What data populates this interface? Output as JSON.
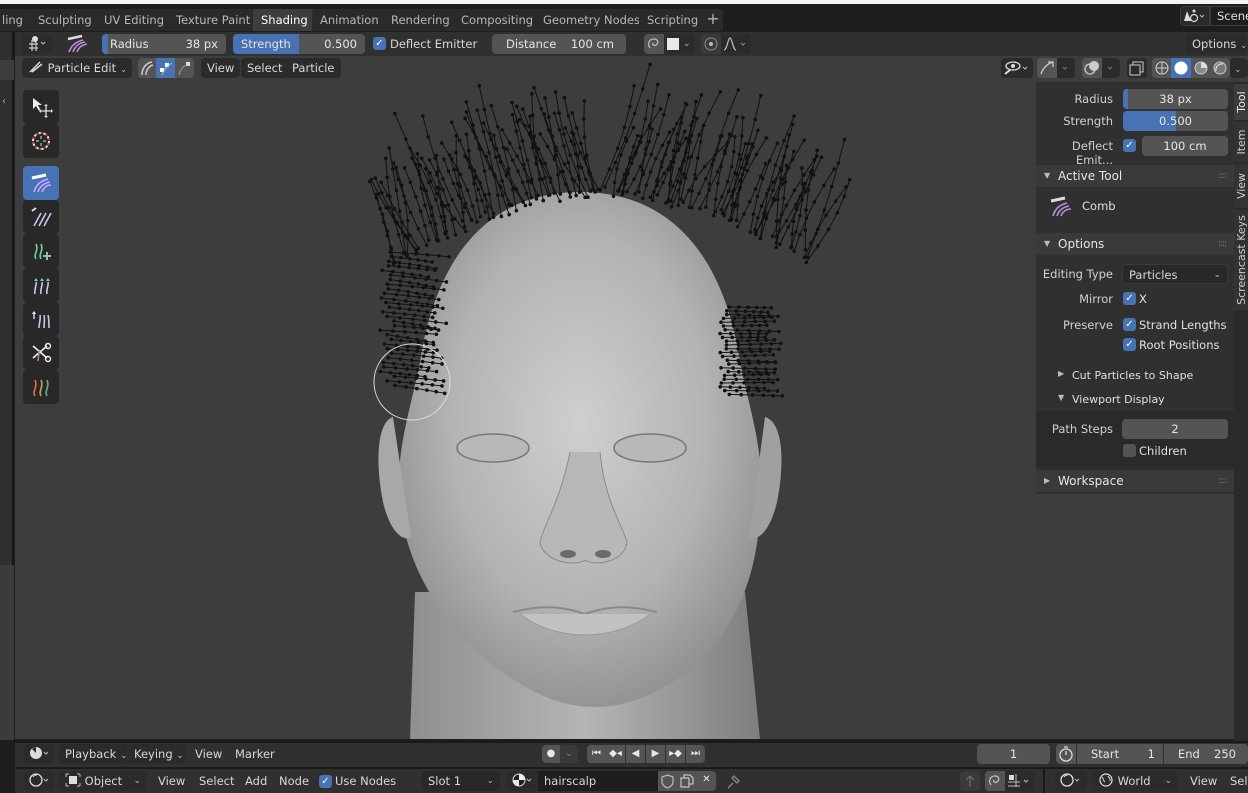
{
  "workspace_tabs": [
    "ling",
    "Sculpting",
    "UV Editing",
    "Texture Paint",
    "Shading",
    "Animation",
    "Rendering",
    "Compositing",
    "Geometry Nodes",
    "Scripting"
  ],
  "active_workspace": "Shading",
  "scene": {
    "name": "Scene",
    "icon": "scene-icon"
  },
  "tool_header": {
    "radius": {
      "label": "Radius",
      "value": "38 px",
      "fraction": 0.05
    },
    "strength": {
      "label": "Strength",
      "value": "0.500",
      "fraction": 0.5
    },
    "deflect_emitter": {
      "label": "Deflect Emitter",
      "checked": true
    },
    "distance": {
      "label": "Distance",
      "value": "100 cm"
    },
    "options_label": "Options"
  },
  "viewport_header": {
    "mode": "Particle Edit",
    "menus": [
      "View",
      "Select",
      "Particle"
    ]
  },
  "toolbar": {
    "tools": [
      {
        "name": "move-select-icon",
        "active": false
      },
      {
        "name": "cursor-icon",
        "active": false
      },
      {
        "name": "comb-icon",
        "active": true
      },
      {
        "name": "smooth-icon",
        "active": false
      },
      {
        "name": "add-icon",
        "active": false
      },
      {
        "name": "length-icon",
        "active": false
      },
      {
        "name": "puff-icon",
        "active": false
      },
      {
        "name": "cut-icon",
        "active": false
      },
      {
        "name": "weight-icon",
        "active": false
      }
    ]
  },
  "npanel": {
    "tabs": [
      "Tool",
      "Item",
      "View",
      "Screencast Keys"
    ],
    "active_tab": "Tool",
    "radius": {
      "label": "Radius",
      "value": "38 px",
      "fraction": 0.05
    },
    "strength": {
      "label": "Strength",
      "value": "0.500",
      "fraction": 0.5
    },
    "deflect": {
      "label": "Deflect Emit...",
      "checked": true,
      "value": "100 cm"
    },
    "active_tool": {
      "title": "Active Tool",
      "tool_name": "Comb"
    },
    "options": {
      "title": "Options",
      "editing_type_label": "Editing Type",
      "editing_type_value": "Particles",
      "mirror_label": "Mirror",
      "mirror_x": {
        "label": "X",
        "checked": true
      },
      "preserve_label": "Preserve",
      "strand_lengths": {
        "label": "Strand Lengths",
        "checked": true
      },
      "root_positions": {
        "label": "Root Positions",
        "checked": true
      },
      "cut_particles": "Cut Particles to Shape",
      "viewport_display": "Viewport Display",
      "path_steps_label": "Path Steps",
      "path_steps_value": "2",
      "children": {
        "label": "Children",
        "checked": false
      }
    },
    "workspace": {
      "title": "Workspace"
    }
  },
  "timeline": {
    "menus": [
      "Playback",
      "Keying",
      "View",
      "Marker"
    ],
    "current_frame": "1",
    "start_label": "Start",
    "start_value": "1",
    "end_label": "End",
    "end_value": "250"
  },
  "bottom_bar": {
    "object_mode": "Object",
    "menus": [
      "View",
      "Select",
      "Add",
      "Node"
    ],
    "use_nodes": {
      "label": "Use Nodes",
      "checked": true
    },
    "slot": "Slot 1",
    "material": "hairscalp",
    "world": "World",
    "right_menus": [
      "View",
      "Sele"
    ]
  }
}
